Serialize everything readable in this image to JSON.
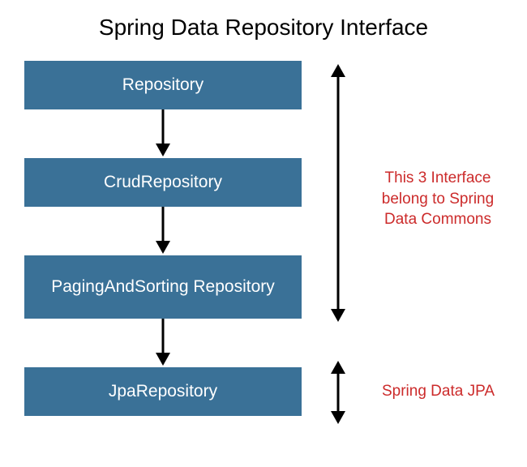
{
  "title": "Spring Data Repository Interface",
  "boxes": [
    {
      "label": "Repository"
    },
    {
      "label": "CrudRepository"
    },
    {
      "label": "PagingAndSorting Repository"
    },
    {
      "label": "JpaRepository"
    }
  ],
  "annotations": [
    {
      "text": "This 3 Interface belong to Spring Data Commons"
    },
    {
      "text": "Spring Data JPA"
    }
  ],
  "colors": {
    "box_bg": "#3a7197",
    "box_text": "#ffffff",
    "annotation": "#cc2b2b"
  }
}
